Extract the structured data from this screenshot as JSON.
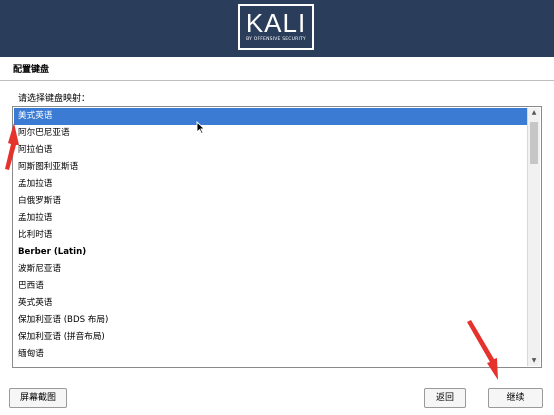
{
  "logo": {
    "text": "KALI",
    "subtitle": "BY OFFENSIVE SECURITY"
  },
  "page": {
    "title": "配置键盘",
    "prompt": "请选择键盘映射："
  },
  "keymap_list": {
    "selected_index": 0,
    "items": [
      {
        "label": "美式英语"
      },
      {
        "label": "阿尔巴尼亚语"
      },
      {
        "label": "阿拉伯语"
      },
      {
        "label": "阿斯图利亚斯语"
      },
      {
        "label": "孟加拉语"
      },
      {
        "label": "白俄罗斯语"
      },
      {
        "label": "孟加拉语"
      },
      {
        "label": "比利时语"
      },
      {
        "label": "Berber (Latin)"
      },
      {
        "label": "波斯尼亚语"
      },
      {
        "label": "巴西语"
      },
      {
        "label": "英式英语"
      },
      {
        "label": "保加利亚语 (BDS 布局)"
      },
      {
        "label": "保加利亚语 (拼音布局)"
      },
      {
        "label": "缅甸语"
      }
    ]
  },
  "buttons": {
    "screenshot": "屏幕截图",
    "back": "返回",
    "continue": "继续"
  },
  "colors": {
    "banner": "#2a3e5c",
    "selection": "#3b7bd4",
    "annotation_arrow": "#e5322d"
  },
  "icons": {
    "scroll_up": "▲",
    "scroll_down": "▼"
  }
}
